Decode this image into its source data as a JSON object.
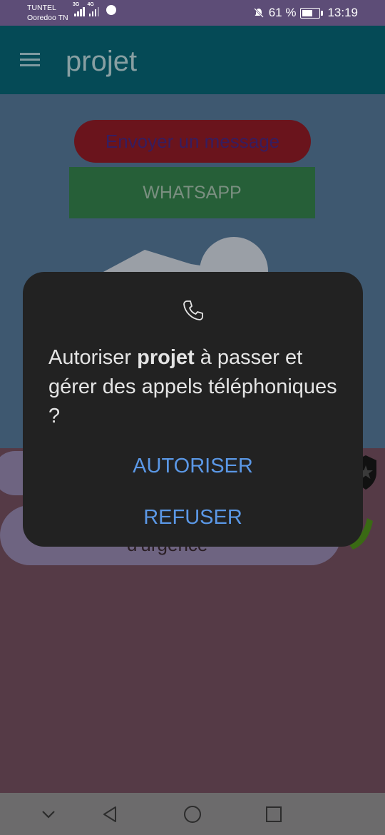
{
  "status_bar": {
    "carrier_1": "TUNTEL",
    "carrier_2": "Ooredoo TN",
    "net_1": "3G",
    "net_2": "4G",
    "battery_percent": "61 %",
    "time": "13:19"
  },
  "app_bar": {
    "title": "projet"
  },
  "background": {
    "send_message_label": "Envoyer un message",
    "whatsapp_label": "WHATSAPP",
    "emergency_label": "d'urgence"
  },
  "dialog": {
    "text_prefix": "Autoriser ",
    "app_name": "projet",
    "text_suffix": " à passer et gérer des appels téléphoniques ?",
    "allow_label": "AUTORISER",
    "deny_label": "REFUSER"
  },
  "colors": {
    "status_bar": "#5d4d77",
    "app_bar": "#054a56",
    "dialog_bg": "#222222",
    "action_text": "#5b98e6"
  }
}
